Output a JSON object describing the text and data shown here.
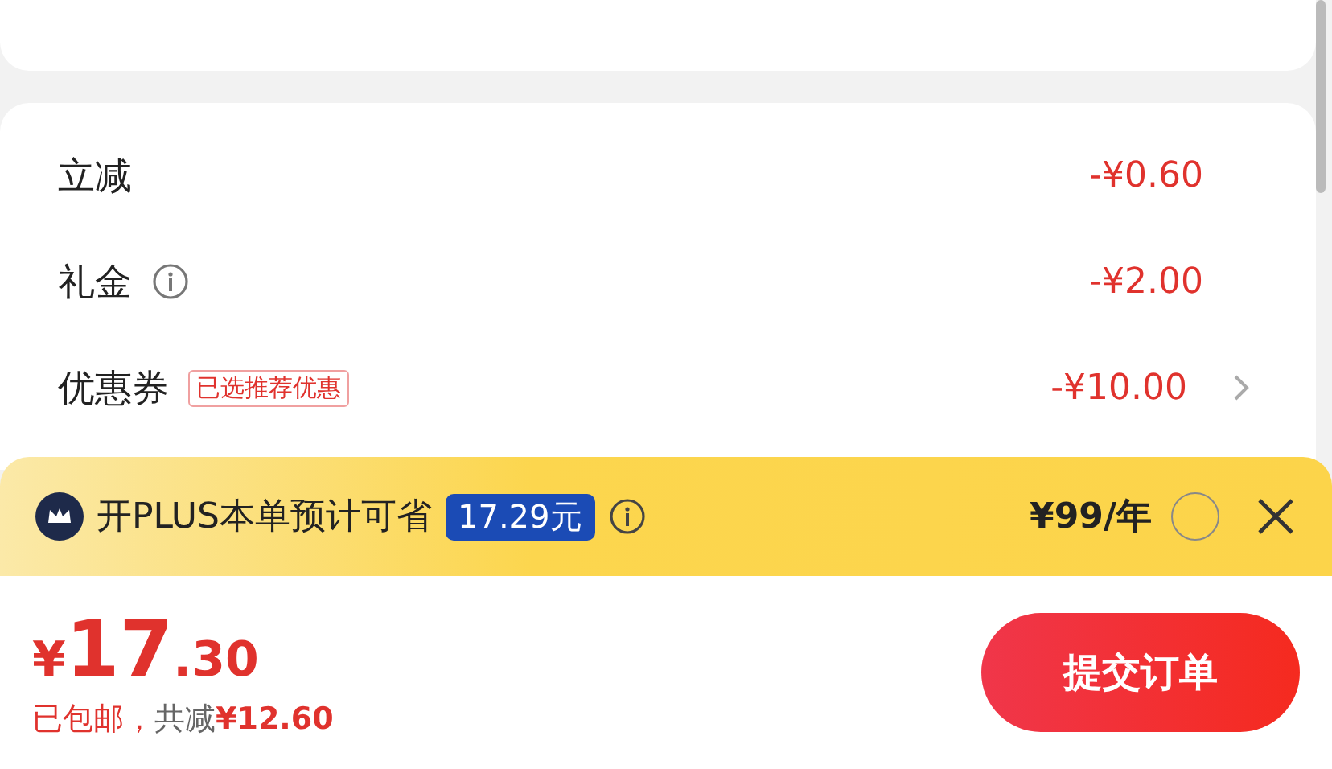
{
  "discounts": [
    {
      "kind": "plain",
      "label": "立减",
      "amount": "-¥0.60"
    },
    {
      "kind": "info",
      "label": "礼金",
      "amount": "-¥2.00"
    },
    {
      "kind": "coupon",
      "label": "优惠券",
      "tag": "已选推荐优惠",
      "amount": "-¥10.00"
    }
  ],
  "plus_banner": {
    "text": "开PLUS本单预计可省",
    "savings": "17.29元",
    "price": "¥99/年",
    "selected": false
  },
  "checkout": {
    "currency": "¥",
    "price_int": "17",
    "price_dec": ".30",
    "shipping": "已包邮，",
    "saved_label": "共减",
    "saved_amount": "¥12.60",
    "submit": "提交订单"
  }
}
